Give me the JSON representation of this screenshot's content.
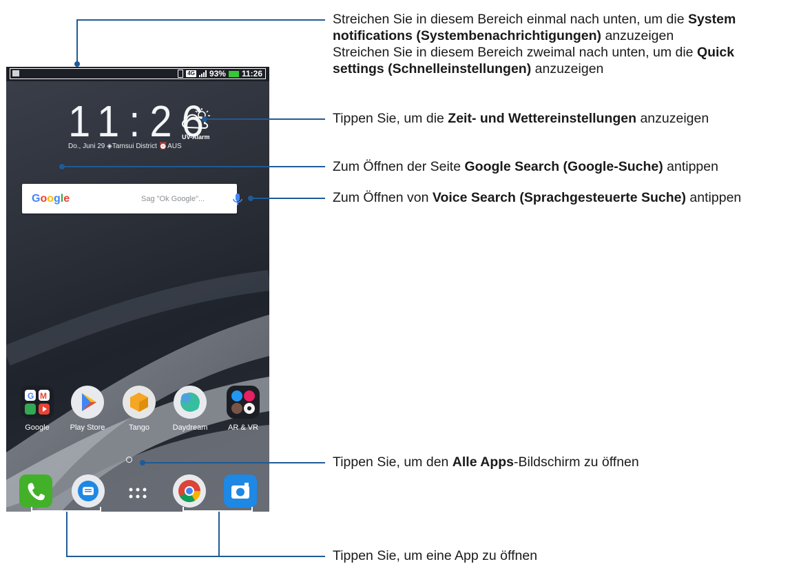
{
  "status_bar": {
    "battery": "93%",
    "time": "11:26",
    "network": "4G"
  },
  "clock_widget": {
    "time": "11:26",
    "weather_label": "UV-Alarm",
    "date": "Do., Juni 29",
    "location": "Tamsui District",
    "alarm": "AUS"
  },
  "search_bar": {
    "logo": "Google",
    "placeholder": "Sag \"Ok Google\"..."
  },
  "home_apps": [
    {
      "label": "Google",
      "icon": "google-folder-icon"
    },
    {
      "label": "Play Store",
      "icon": "play-store-icon"
    },
    {
      "label": "Tango",
      "icon": "tango-icon"
    },
    {
      "label": "Daydream",
      "icon": "daydream-icon"
    },
    {
      "label": "AR & VR",
      "icon": "ar-vr-folder-icon"
    }
  ],
  "dock": [
    "phone-icon",
    "messages-icon",
    "all-apps-icon",
    "chrome-icon",
    "camera-icon"
  ],
  "callouts": {
    "status": {
      "l1a": "Streichen Sie in diesem Bereich einmal nach unten, um die ",
      "l1b": "System",
      "l2a": "notifications (Systembenachrichtigungen)",
      "l2b": " anzuzeigen",
      "l3a": "Streichen Sie in diesem Bereich zweimal nach unten, um die ",
      "l3b": "Quick",
      "l4a": "settings (Schnelleinstellungen)",
      "l4b": " anzuzeigen"
    },
    "clock": {
      "a": "Tippen Sie, um die ",
      "b": "Zeit- und Wettereinstellungen",
      "c": " anzuzeigen"
    },
    "google": {
      "a": "Zum Öffnen der Seite ",
      "b": "Google Search (Google-Suche)",
      "c": " antippen"
    },
    "voice": {
      "a": "Zum Öffnen von ",
      "b": "Voice Search (Sprachgesteuerte Suche)",
      "c": " antippen"
    },
    "allapps": {
      "a": "Tippen Sie, um den ",
      "b": "Alle Apps",
      "c": "-Bildschirm zu öffnen"
    },
    "openapp": {
      "a": "Tippen Sie, um eine App zu öffnen"
    }
  },
  "colors": {
    "leader_line": "#1f5a96",
    "accent_blue": "#4285f4"
  }
}
